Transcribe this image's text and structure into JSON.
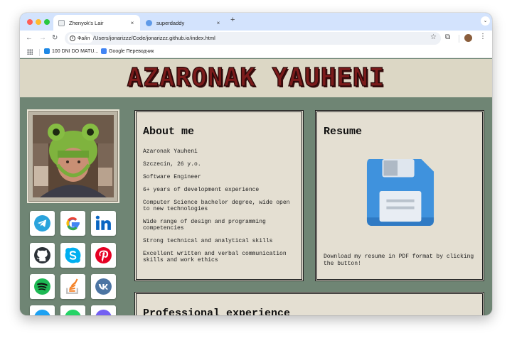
{
  "browser": {
    "tabs": [
      {
        "title": "Zhenyok's Lair",
        "active": true,
        "close": "×"
      },
      {
        "title": "superdaddy",
        "active": false,
        "close": "×"
      }
    ],
    "new_tab": "+",
    "tab_menu": "⌄",
    "nav": {
      "back": "←",
      "forward": "→",
      "reload": "↻"
    },
    "omnibox": {
      "info_icon": "i",
      "site_info_label": "Файл",
      "url": "/Users/jonarizzz/Code/jonarizzz.github.io/index.html",
      "star": "☆"
    },
    "extensions_icon": "⧉",
    "menu_icon": "⋮",
    "bookmarks": [
      {
        "label": "100 DNI DO MATU..."
      },
      {
        "label": "Google Переводчик"
      }
    ]
  },
  "page": {
    "site_title": "AZARONAK YAUHENI",
    "socials": [
      "telegram",
      "google",
      "linkedin",
      "github",
      "skype",
      "pinterest",
      "spotify",
      "stackoverflow",
      "vk"
    ],
    "about": {
      "title": "About me",
      "lines": [
        "Azaronak Yauheni",
        "Szczecin, 26 y.o.",
        "Software Engineer",
        "6+ years of development experience",
        "Computer Science bachelor degree, wide open to new technologies",
        "Wide range of design and programming competencies",
        "Strong technical and analytical skills",
        "Excellent written and verbal communication skills and work ethics"
      ]
    },
    "resume": {
      "title": "Resume",
      "text": "Download my resume in PDF format by clicking the button!"
    },
    "experience": {
      "title": "Professional experience"
    }
  },
  "colors": {
    "page_bg": "#6f8574",
    "header_bg": "#dcd7c5",
    "card_bg": "#e4dfd2",
    "title_red": "#7b1b1b",
    "floppy_blue": "#3f92dd"
  }
}
